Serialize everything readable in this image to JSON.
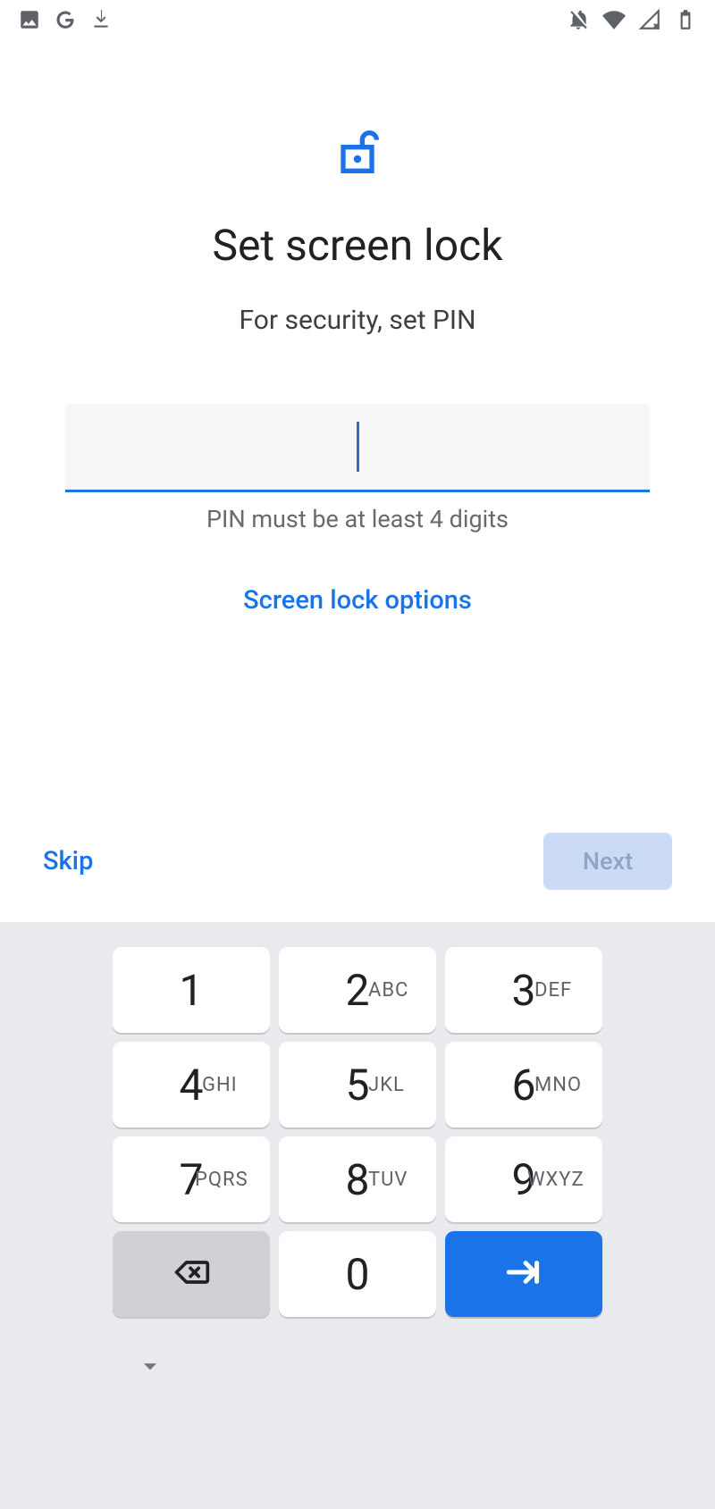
{
  "status_bar": {
    "left_icons": [
      "photos-icon",
      "google-icon",
      "download-icon"
    ],
    "right_icons": [
      "dnd-off-icon",
      "wifi-icon",
      "signal-no-data-icon",
      "battery-icon"
    ]
  },
  "screen": {
    "title": "Set screen lock",
    "subtitle": "For security, set PIN",
    "pin_value": "",
    "hint": "PIN must be at least 4 digits",
    "options_link": "Screen lock options"
  },
  "actions": {
    "skip": "Skip",
    "next": "Next",
    "next_enabled": false
  },
  "keypad": {
    "keys": [
      {
        "digit": "1",
        "letters": ""
      },
      {
        "digit": "2",
        "letters": "ABC"
      },
      {
        "digit": "3",
        "letters": "DEF"
      },
      {
        "digit": "4",
        "letters": "GHI"
      },
      {
        "digit": "5",
        "letters": "JKL"
      },
      {
        "digit": "6",
        "letters": "MNO"
      },
      {
        "digit": "7",
        "letters": "PQRS"
      },
      {
        "digit": "8",
        "letters": "TUV"
      },
      {
        "digit": "9",
        "letters": "WXYZ"
      },
      {
        "type": "backspace"
      },
      {
        "digit": "0",
        "letters": ""
      },
      {
        "type": "enter"
      }
    ]
  },
  "colors": {
    "accent": "#1a73e8",
    "keypad_bg": "#e8eaed",
    "disabled_btn_bg": "#cbdbf6",
    "disabled_btn_fg": "#8fa5c7"
  }
}
